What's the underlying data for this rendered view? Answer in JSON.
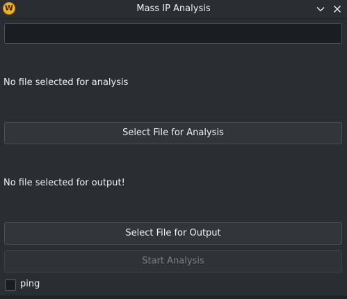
{
  "window": {
    "title": "Mass IP Analysis",
    "icon_letter": "W",
    "minimize_icon": "chevron-down-icon",
    "close_icon": "close-icon"
  },
  "input": {
    "value": "",
    "placeholder": ""
  },
  "analysis": {
    "status": "No file selected for analysis",
    "button_label": "Select File for Analysis"
  },
  "output": {
    "status": "No file selected for output!",
    "button_label": "Select File for Output"
  },
  "start": {
    "button_label": "Start Analysis",
    "enabled": false
  },
  "ping": {
    "label": "ping",
    "checked": false
  },
  "colors": {
    "background": "#2a2e32",
    "field_background": "#1b1e20",
    "button_background": "#31363b",
    "border": "#4d5257",
    "text": "#eff0f1",
    "disabled_text": "#7a7f84",
    "app_icon": "#f2b21c"
  }
}
